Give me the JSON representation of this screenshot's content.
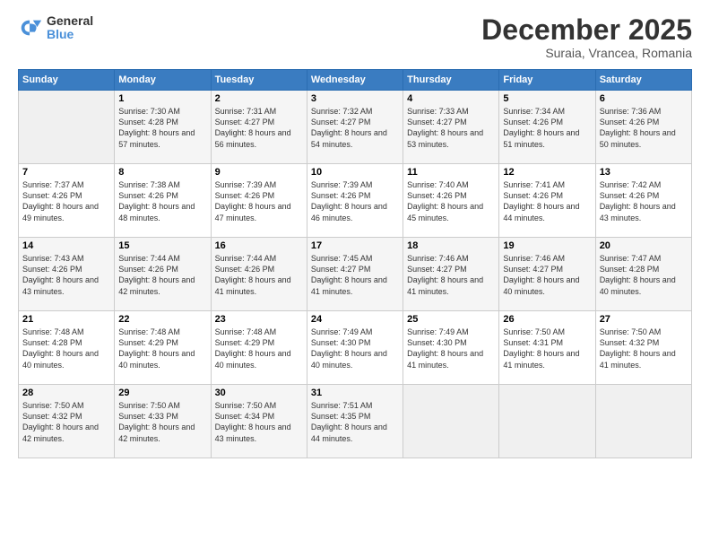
{
  "header": {
    "logo_line1": "General",
    "logo_line2": "Blue",
    "month_title": "December 2025",
    "location": "Suraia, Vrancea, Romania"
  },
  "calendar": {
    "days_of_week": [
      "Sunday",
      "Monday",
      "Tuesday",
      "Wednesday",
      "Thursday",
      "Friday",
      "Saturday"
    ],
    "weeks": [
      [
        {
          "day": "",
          "sunrise": "",
          "sunset": "",
          "daylight": ""
        },
        {
          "day": "1",
          "sunrise": "Sunrise: 7:30 AM",
          "sunset": "Sunset: 4:28 PM",
          "daylight": "Daylight: 8 hours and 57 minutes."
        },
        {
          "day": "2",
          "sunrise": "Sunrise: 7:31 AM",
          "sunset": "Sunset: 4:27 PM",
          "daylight": "Daylight: 8 hours and 56 minutes."
        },
        {
          "day": "3",
          "sunrise": "Sunrise: 7:32 AM",
          "sunset": "Sunset: 4:27 PM",
          "daylight": "Daylight: 8 hours and 54 minutes."
        },
        {
          "day": "4",
          "sunrise": "Sunrise: 7:33 AM",
          "sunset": "Sunset: 4:27 PM",
          "daylight": "Daylight: 8 hours and 53 minutes."
        },
        {
          "day": "5",
          "sunrise": "Sunrise: 7:34 AM",
          "sunset": "Sunset: 4:26 PM",
          "daylight": "Daylight: 8 hours and 51 minutes."
        },
        {
          "day": "6",
          "sunrise": "Sunrise: 7:36 AM",
          "sunset": "Sunset: 4:26 PM",
          "daylight": "Daylight: 8 hours and 50 minutes."
        }
      ],
      [
        {
          "day": "7",
          "sunrise": "Sunrise: 7:37 AM",
          "sunset": "Sunset: 4:26 PM",
          "daylight": "Daylight: 8 hours and 49 minutes."
        },
        {
          "day": "8",
          "sunrise": "Sunrise: 7:38 AM",
          "sunset": "Sunset: 4:26 PM",
          "daylight": "Daylight: 8 hours and 48 minutes."
        },
        {
          "day": "9",
          "sunrise": "Sunrise: 7:39 AM",
          "sunset": "Sunset: 4:26 PM",
          "daylight": "Daylight: 8 hours and 47 minutes."
        },
        {
          "day": "10",
          "sunrise": "Sunrise: 7:39 AM",
          "sunset": "Sunset: 4:26 PM",
          "daylight": "Daylight: 8 hours and 46 minutes."
        },
        {
          "day": "11",
          "sunrise": "Sunrise: 7:40 AM",
          "sunset": "Sunset: 4:26 PM",
          "daylight": "Daylight: 8 hours and 45 minutes."
        },
        {
          "day": "12",
          "sunrise": "Sunrise: 7:41 AM",
          "sunset": "Sunset: 4:26 PM",
          "daylight": "Daylight: 8 hours and 44 minutes."
        },
        {
          "day": "13",
          "sunrise": "Sunrise: 7:42 AM",
          "sunset": "Sunset: 4:26 PM",
          "daylight": "Daylight: 8 hours and 43 minutes."
        }
      ],
      [
        {
          "day": "14",
          "sunrise": "Sunrise: 7:43 AM",
          "sunset": "Sunset: 4:26 PM",
          "daylight": "Daylight: 8 hours and 43 minutes."
        },
        {
          "day": "15",
          "sunrise": "Sunrise: 7:44 AM",
          "sunset": "Sunset: 4:26 PM",
          "daylight": "Daylight: 8 hours and 42 minutes."
        },
        {
          "day": "16",
          "sunrise": "Sunrise: 7:44 AM",
          "sunset": "Sunset: 4:26 PM",
          "daylight": "Daylight: 8 hours and 41 minutes."
        },
        {
          "day": "17",
          "sunrise": "Sunrise: 7:45 AM",
          "sunset": "Sunset: 4:27 PM",
          "daylight": "Daylight: 8 hours and 41 minutes."
        },
        {
          "day": "18",
          "sunrise": "Sunrise: 7:46 AM",
          "sunset": "Sunset: 4:27 PM",
          "daylight": "Daylight: 8 hours and 41 minutes."
        },
        {
          "day": "19",
          "sunrise": "Sunrise: 7:46 AM",
          "sunset": "Sunset: 4:27 PM",
          "daylight": "Daylight: 8 hours and 40 minutes."
        },
        {
          "day": "20",
          "sunrise": "Sunrise: 7:47 AM",
          "sunset": "Sunset: 4:28 PM",
          "daylight": "Daylight: 8 hours and 40 minutes."
        }
      ],
      [
        {
          "day": "21",
          "sunrise": "Sunrise: 7:48 AM",
          "sunset": "Sunset: 4:28 PM",
          "daylight": "Daylight: 8 hours and 40 minutes."
        },
        {
          "day": "22",
          "sunrise": "Sunrise: 7:48 AM",
          "sunset": "Sunset: 4:29 PM",
          "daylight": "Daylight: 8 hours and 40 minutes."
        },
        {
          "day": "23",
          "sunrise": "Sunrise: 7:48 AM",
          "sunset": "Sunset: 4:29 PM",
          "daylight": "Daylight: 8 hours and 40 minutes."
        },
        {
          "day": "24",
          "sunrise": "Sunrise: 7:49 AM",
          "sunset": "Sunset: 4:30 PM",
          "daylight": "Daylight: 8 hours and 40 minutes."
        },
        {
          "day": "25",
          "sunrise": "Sunrise: 7:49 AM",
          "sunset": "Sunset: 4:30 PM",
          "daylight": "Daylight: 8 hours and 41 minutes."
        },
        {
          "day": "26",
          "sunrise": "Sunrise: 7:50 AM",
          "sunset": "Sunset: 4:31 PM",
          "daylight": "Daylight: 8 hours and 41 minutes."
        },
        {
          "day": "27",
          "sunrise": "Sunrise: 7:50 AM",
          "sunset": "Sunset: 4:32 PM",
          "daylight": "Daylight: 8 hours and 41 minutes."
        }
      ],
      [
        {
          "day": "28",
          "sunrise": "Sunrise: 7:50 AM",
          "sunset": "Sunset: 4:32 PM",
          "daylight": "Daylight: 8 hours and 42 minutes."
        },
        {
          "day": "29",
          "sunrise": "Sunrise: 7:50 AM",
          "sunset": "Sunset: 4:33 PM",
          "daylight": "Daylight: 8 hours and 42 minutes."
        },
        {
          "day": "30",
          "sunrise": "Sunrise: 7:50 AM",
          "sunset": "Sunset: 4:34 PM",
          "daylight": "Daylight: 8 hours and 43 minutes."
        },
        {
          "day": "31",
          "sunrise": "Sunrise: 7:51 AM",
          "sunset": "Sunset: 4:35 PM",
          "daylight": "Daylight: 8 hours and 44 minutes."
        },
        {
          "day": "",
          "sunrise": "",
          "sunset": "",
          "daylight": ""
        },
        {
          "day": "",
          "sunrise": "",
          "sunset": "",
          "daylight": ""
        },
        {
          "day": "",
          "sunrise": "",
          "sunset": "",
          "daylight": ""
        }
      ]
    ]
  }
}
